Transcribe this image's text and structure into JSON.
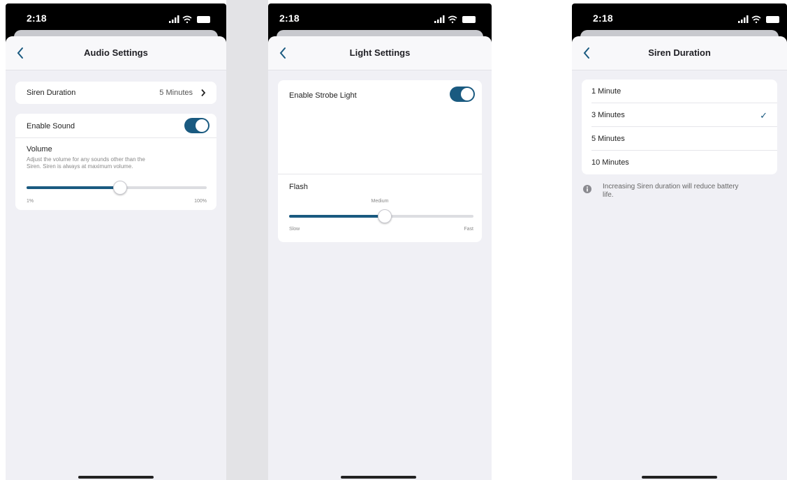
{
  "status": {
    "time": "2:18"
  },
  "audio": {
    "title": "Audio Settings",
    "siren_label": "Siren Duration",
    "siren_value": "5 Minutes",
    "enable_sound_label": "Enable Sound",
    "enable_sound_on": true,
    "volume_label": "Volume",
    "volume_desc_1": "Adjust the volume for any sounds other than the",
    "volume_desc_2": "Siren. Siren is always at maximum volume.",
    "volume_level": 0.52,
    "volume_min": "1%",
    "volume_max": "100%"
  },
  "light": {
    "title": "Light Settings",
    "strobe_label": "Enable Strobe Light",
    "strobe_on": true,
    "flash_label": "Flash",
    "flash_value": "Medium",
    "flash_level": 0.52,
    "flash_min": "Slow",
    "flash_max": "Fast"
  },
  "siren": {
    "title": "Siren Duration",
    "options": [
      {
        "label": "1 Minute",
        "selected": false
      },
      {
        "label": "3 Minutes",
        "selected": true
      },
      {
        "label": "5 Minutes",
        "selected": false
      },
      {
        "label": "10 Minutes",
        "selected": false
      }
    ],
    "note": "Increasing Siren duration will reduce battery",
    "note_2": "life."
  },
  "colors": {
    "accent": "#1a5a80",
    "background": "#f0f0f5",
    "gap": "#e3e3e6"
  }
}
